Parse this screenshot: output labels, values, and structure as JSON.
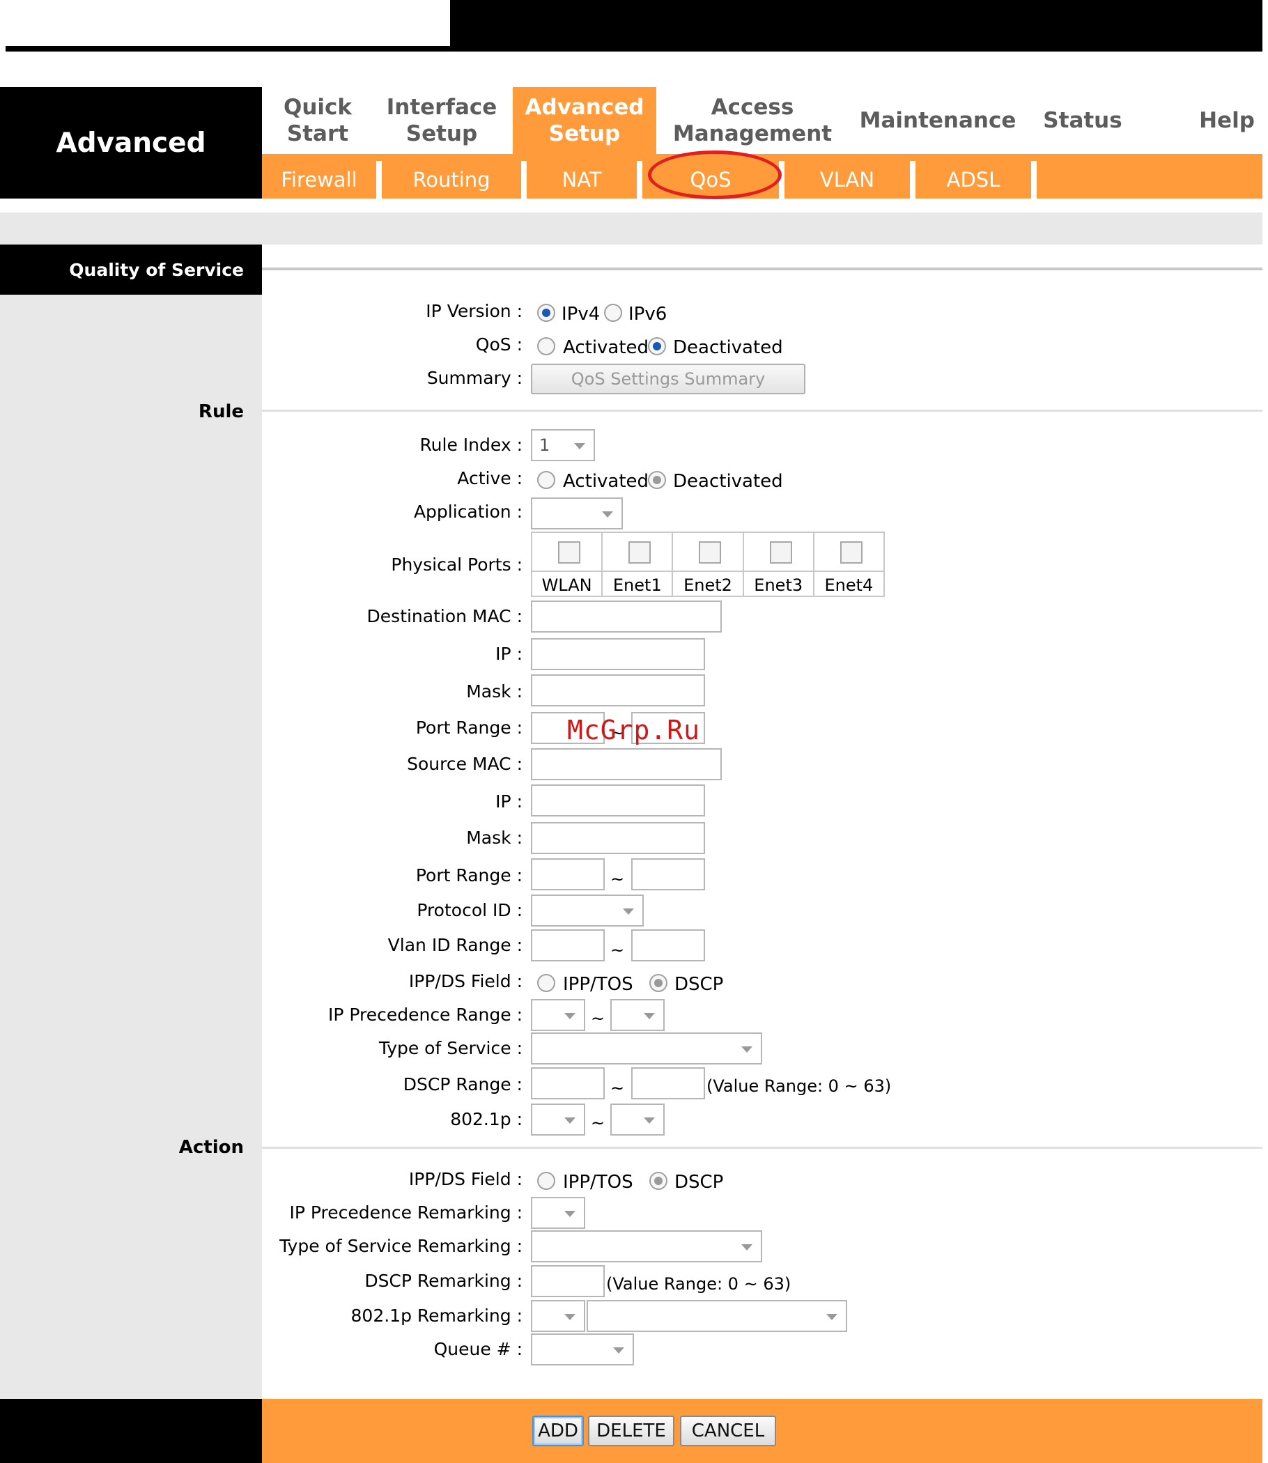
{
  "header": {
    "section_title": "Advanced"
  },
  "main_tabs": [
    {
      "label_line1": "Quick",
      "label_line2": "Start"
    },
    {
      "label_line1": "Interface",
      "label_line2": "Setup"
    },
    {
      "label_line1": "Advanced",
      "label_line2": "Setup",
      "active": true
    },
    {
      "label_line1": "Access",
      "label_line2": "Management"
    },
    {
      "label_line1": "Maintenance",
      "label_line2": ""
    },
    {
      "label_line1": "Status",
      "label_line2": ""
    },
    {
      "label_line1": "Help",
      "label_line2": ""
    }
  ],
  "sub_tabs": [
    "Firewall",
    "Routing",
    "NAT",
    "QoS",
    "VLAN",
    "ADSL"
  ],
  "sidebar": {
    "page_heading": "Quality of Service",
    "rule_label": "Rule",
    "action_label": "Action"
  },
  "qos_general": {
    "ip_version_label": "IP Version :",
    "ipv4": "IPv4",
    "ipv6": "IPv6",
    "qos_label": "QoS :",
    "activated": "Activated",
    "deactivated": "Deactivated",
    "summary_label": "Summary :",
    "summary_button": "QoS Settings Summary"
  },
  "rule": {
    "rule_index_label": "Rule Index :",
    "rule_index_value": "1",
    "active_label": "Active :",
    "activated": "Activated",
    "deactivated": "Deactivated",
    "application_label": "Application :",
    "physical_ports_label": "Physical Ports :",
    "ports": [
      "WLAN",
      "Enet1",
      "Enet2",
      "Enet3",
      "Enet4"
    ],
    "dest_mac_label": "Destination MAC :",
    "ip_label": "IP :",
    "mask_label": "Mask :",
    "port_range_label": "Port Range :",
    "source_mac_label": "Source MAC :",
    "protocol_id_label": "Protocol ID :",
    "vlan_id_range_label": "Vlan ID Range :",
    "ippds_label": "IPP/DS Field :",
    "ipptos": "IPP/TOS",
    "dscp": "DSCP",
    "ip_precedence_range_label": "IP Precedence Range :",
    "type_of_service_label": "Type of Service :",
    "dscp_range_label": "DSCP Range :",
    "dscp_hint": "(Value Range: 0 ~ 63)",
    "dot1p_label": "802.1p :",
    "tilde": "~"
  },
  "action": {
    "ippds_label": "IPP/DS Field :",
    "ipptos": "IPP/TOS",
    "dscp": "DSCP",
    "ip_precedence_remarking_label": "IP Precedence Remarking :",
    "tos_remarking_label": "Type of Service Remarking :",
    "dscp_remarking_label": "DSCP Remarking :",
    "dscp_hint": "(Value Range: 0 ~ 63)",
    "dot1p_remarking_label": "802.1p Remarking :",
    "queue_label": "Queue # :"
  },
  "footer": {
    "add": "ADD",
    "delete": "DELETE",
    "cancel": "CANCEL"
  },
  "watermark": "McGrp.Ru",
  "colors": {
    "accent": "#ff9b3a",
    "highlight_ring": "#e02020",
    "side_gray": "#e8e8e8"
  }
}
